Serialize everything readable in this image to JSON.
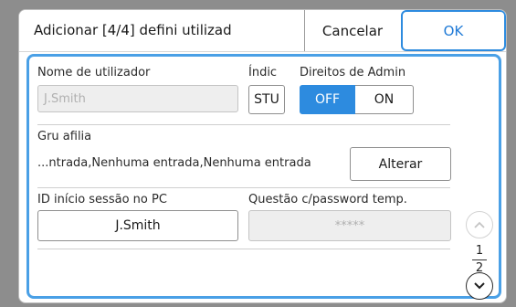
{
  "header": {
    "title": "Adicionar [4/4] defini utilizad",
    "cancel_label": "Cancelar",
    "ok_label": "OK"
  },
  "user_name": {
    "label": "Nome de utilizador",
    "value": "J.Smith"
  },
  "index": {
    "label": "Índic",
    "value": "STU"
  },
  "admin_rights": {
    "label": "Direitos de Admin",
    "off_label": "OFF",
    "on_label": "ON",
    "selected": "OFF"
  },
  "group": {
    "label": "Gru afilia",
    "value": "...ntrada,Nenhuma entrada,Nenhuma entrada",
    "change_label": "Alterar"
  },
  "pc_login": {
    "label": "ID início sessão no PC",
    "value": "J.Smith"
  },
  "temp_password": {
    "label": "Questão c/password temp.",
    "value": "*****"
  },
  "pager": {
    "current": "1",
    "total": "2"
  },
  "colors": {
    "accent": "#2d8bdf",
    "frame": "#4aa0e6"
  }
}
